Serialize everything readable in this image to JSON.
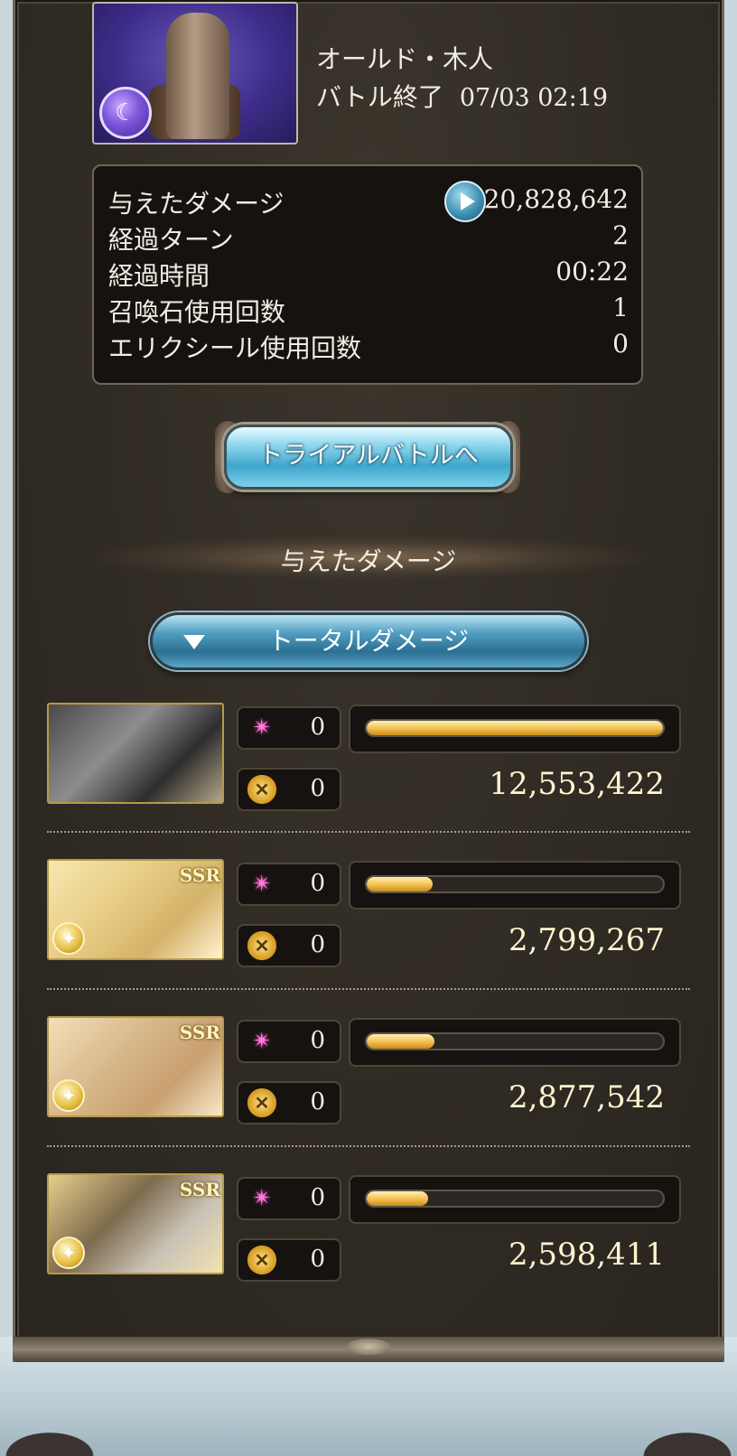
{
  "enemy": {
    "name": "オールド・木人",
    "battle_end_label": "バトル終了",
    "datetime": "07/03 02:19",
    "element_icon": "dark-element-icon"
  },
  "stats": [
    {
      "label": "与えたダメージ",
      "value": "20,828,642"
    },
    {
      "label": "経過ターン",
      "value": "2"
    },
    {
      "label": "経過時間",
      "value": "00:22"
    },
    {
      "label": "召喚石使用回数",
      "value": "1"
    },
    {
      "label": "エリクシール使用回数",
      "value": "0"
    }
  ],
  "trial_button": "トライアルバトルへ",
  "damage_heading": "与えたダメージ",
  "total_dropdown": "トータルダメージ",
  "characters": [
    {
      "ca_count": "0",
      "skill_count": "0",
      "damage": "12,553,422",
      "bar_fraction": 1.0,
      "ssr": "",
      "element": ""
    },
    {
      "ca_count": "0",
      "skill_count": "0",
      "damage": "2,799,267",
      "bar_fraction": 0.223,
      "ssr": "SSR",
      "element": "light"
    },
    {
      "ca_count": "0",
      "skill_count": "0",
      "damage": "2,877,542",
      "bar_fraction": 0.229,
      "ssr": "SSR",
      "element": "light"
    },
    {
      "ca_count": "0",
      "skill_count": "0",
      "damage": "2,598,411",
      "bar_fraction": 0.207,
      "ssr": "SSR",
      "element": "light"
    }
  ],
  "colors": {
    "panel": "#2f2a23",
    "bar_fill": "#f2bf4b",
    "accent_blue": "#3fa6cb"
  }
}
